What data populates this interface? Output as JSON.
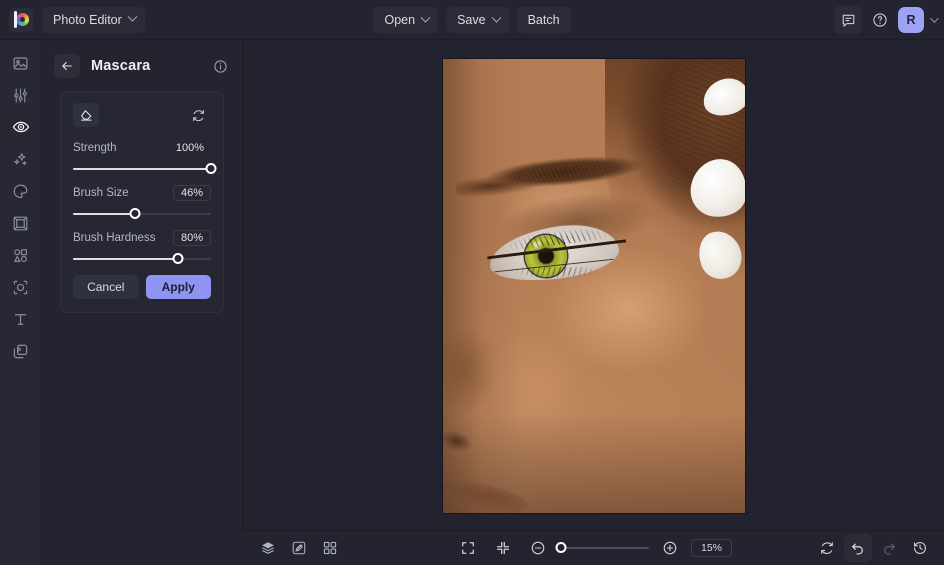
{
  "app": {
    "logo_name": "befunky-logo",
    "accent_color": "#8f93f2",
    "avatar_color": "#9ea2f5",
    "panel_bg": "#262733",
    "app_bg": "#23242f"
  },
  "topbar": {
    "mode_menu": {
      "label": "Photo Editor",
      "icon": "chevron-down-icon"
    },
    "open_button": {
      "label": "Open",
      "icon": "chevron-down-icon"
    },
    "save_button": {
      "label": "Save",
      "icon": "chevron-down-icon"
    },
    "batch_button": {
      "label": "Batch"
    },
    "feedback_icon": "chat-bubble-icon",
    "help_icon": "question-circle-icon",
    "avatar_initial": "R",
    "account_chevron_icon": "chevron-down-icon"
  },
  "sidebar": {
    "items": [
      {
        "name": "sidebar-item-edit",
        "icon": "image-icon",
        "active": false
      },
      {
        "name": "sidebar-item-adjust",
        "icon": "sliders-icon",
        "active": false
      },
      {
        "name": "sidebar-item-touchup",
        "icon": "eye-icon",
        "active": true
      },
      {
        "name": "sidebar-item-effects",
        "icon": "sparkles-icon",
        "active": false
      },
      {
        "name": "sidebar-item-artsy",
        "icon": "palette-icon",
        "active": false
      },
      {
        "name": "sidebar-item-frames",
        "icon": "frame-icon",
        "active": false
      },
      {
        "name": "sidebar-item-graphics",
        "icon": "shapes-icon",
        "active": false
      },
      {
        "name": "sidebar-item-overlays",
        "icon": "overlay-icon",
        "active": false
      },
      {
        "name": "sidebar-item-text",
        "icon": "text-icon",
        "active": false
      },
      {
        "name": "sidebar-item-layers",
        "icon": "layers-copy-icon",
        "active": false
      }
    ]
  },
  "panel": {
    "back_icon": "arrow-left-icon",
    "title": "Mascara",
    "info_icon": "info-circle-icon",
    "tools": {
      "erase_icon": "eraser-icon",
      "reset_icon": "reset-icon"
    },
    "sliders": [
      {
        "label": "Strength",
        "value": "100%",
        "percent": 100,
        "boxed": false
      },
      {
        "label": "Brush Size",
        "value": "46%",
        "percent": 46,
        "boxed": true
      },
      {
        "label": "Brush Hardness",
        "value": "80%",
        "percent": 80,
        "boxed": true
      }
    ],
    "cancel_label": "Cancel",
    "apply_label": "Apply"
  },
  "canvas": {
    "image_description": "Close-up portrait of a woman's left eye with green hazel iris, dark mascara lashes and white flowers in her hair"
  },
  "bottombar": {
    "left_icons": [
      {
        "name": "layers-button",
        "icon": "layers-icon"
      },
      {
        "name": "image-manager-button",
        "icon": "image-link-icon"
      },
      {
        "name": "grid-view-button",
        "icon": "grid-icon"
      }
    ],
    "center": {
      "fit_screen_icon": "expand-frame-icon",
      "actual-size_icon": "collapse-arrows-icon",
      "zoom_out_icon": "zoom-minus-icon",
      "zoom_in_icon": "zoom-plus-icon",
      "zoom_value": "15%",
      "zoom_percent": 2
    },
    "right_icons": [
      {
        "name": "reset-image-button",
        "icon": "reset-icon",
        "disabled": false
      },
      {
        "name": "undo-button",
        "icon": "undo-icon",
        "disabled": false
      },
      {
        "name": "redo-button",
        "icon": "redo-icon",
        "disabled": true
      },
      {
        "name": "history-button",
        "icon": "history-icon",
        "disabled": false
      }
    ]
  }
}
